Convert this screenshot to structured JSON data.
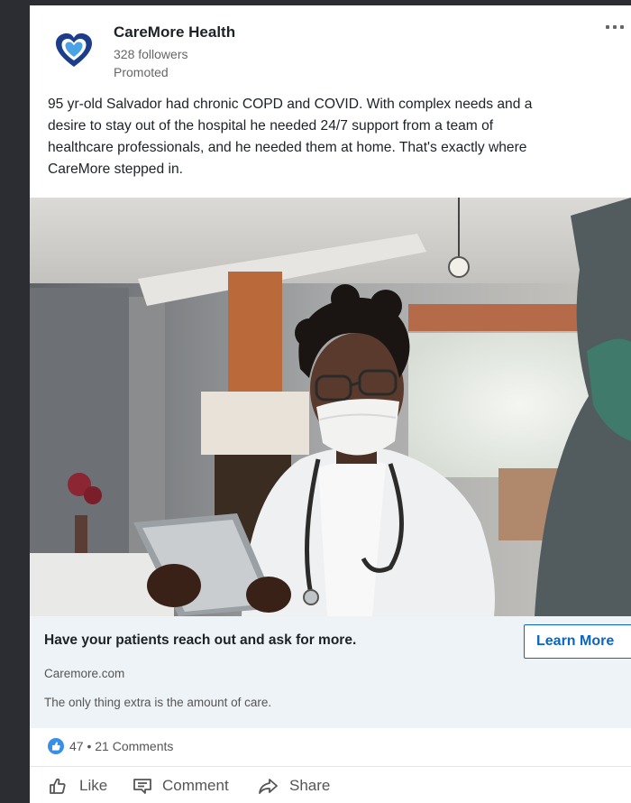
{
  "post": {
    "company": "CareMore Health",
    "followers": "328 followers",
    "promoted": "Promoted",
    "lines": [
      "95 yr-old Salvador had chronic COPD and COVID. With complex needs and a",
      "desire to stay out of the hospital he needed 24/7 support from a team of",
      "healthcare professionals, and he needed them at home. That's exactly where",
      "CareMore stepped in."
    ],
    "icons": {
      "logo": "heart-logo-icon",
      "more": "more-options-icon"
    }
  },
  "cta": {
    "headline": "Have your patients reach out and ask for more.",
    "domain": "Caremore.com",
    "subtext": "The only thing extra is the amount of care.",
    "button": "Learn More"
  },
  "social": {
    "count": "47 • 21 Comments",
    "icon": "like-reaction-icon"
  },
  "actions": [
    {
      "label": "Like",
      "icon": "thumbs-up-icon"
    },
    {
      "label": "Comment",
      "icon": "comment-icon"
    },
    {
      "label": "Share",
      "icon": "share-icon"
    }
  ],
  "colors": {
    "accent": "#0a66c2",
    "background": "#2b2d33",
    "cta_bg": "#eef3f8",
    "heart": "#4aa3e6"
  }
}
